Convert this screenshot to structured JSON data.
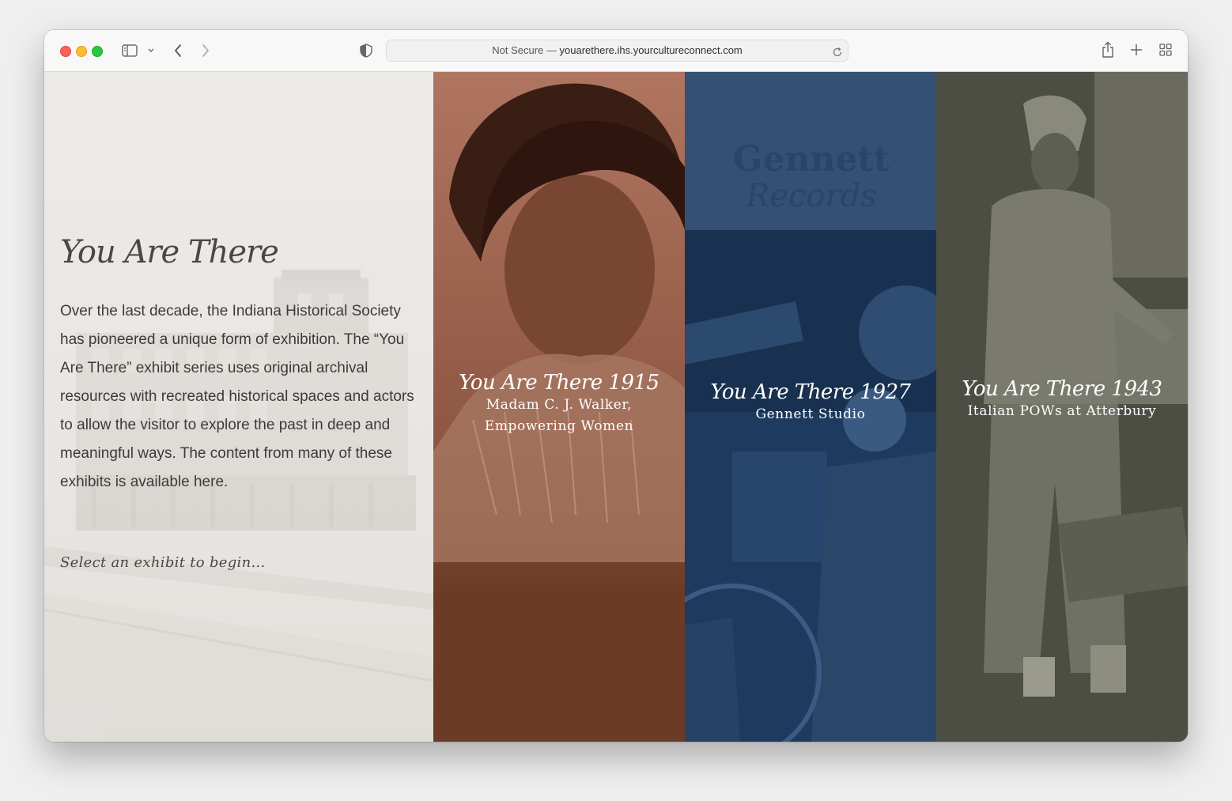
{
  "browser": {
    "url_prefix": "Not Secure —",
    "url_host": "youarethere.ihs.yourcultureconnect.com"
  },
  "intro": {
    "brand": "You Are There",
    "body": "Over the last decade, the Indiana Historical Society has pioneered a unique form of exhibition. The “You Are There” exhibit series uses original archival resources with recreated historical spaces and actors to allow the visitor to explore the past in deep and meaningful ways. The content from many of these exhibits is available here.",
    "prompt": "Select an exhibit to begin..."
  },
  "exhibits": [
    {
      "script": "You Are There 1915",
      "title_line1": "Madam C. J. Walker,",
      "title_line2": "Empowering Women",
      "color": "#6b3b27"
    },
    {
      "script": "You Are There 1927",
      "title_line1": "Gennett Studio",
      "title_line2": "",
      "color": "#1f3a5f",
      "sign_line1": "Gennett",
      "sign_line2": "Records"
    },
    {
      "script": "You Are There 1943",
      "title_line1": "Italian POWs at Atterbury",
      "title_line2": "",
      "color": "#4c4d43"
    }
  ],
  "colors": {
    "intro_bg": "#ecebe8",
    "text": "#3d3b39"
  }
}
